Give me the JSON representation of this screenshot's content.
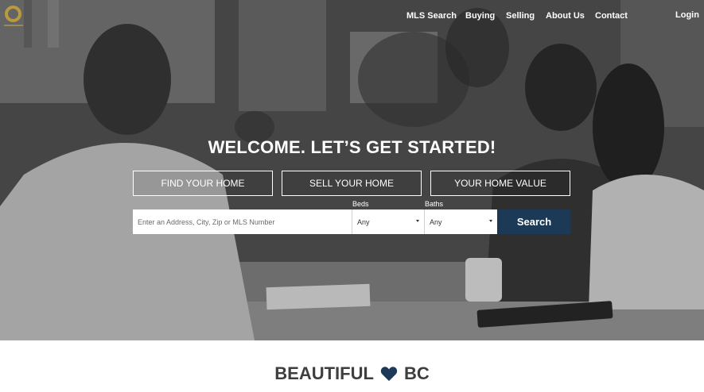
{
  "nav": {
    "items": [
      {
        "label": "MLS Search",
        "icon": ""
      },
      {
        "label": "Buying"
      },
      {
        "label": "Selling"
      },
      {
        "label": "About Us"
      },
      {
        "label": "Contact"
      }
    ],
    "login_label": "Login"
  },
  "logo": {
    "icon": "brand-ring-logo",
    "color": "#b89b3e"
  },
  "hero": {
    "headline": "WELCOME. LET’S GET STARTED!",
    "options": [
      "FIND YOUR HOME",
      "SELL YOUR HOME",
      "YOUR HOME VALUE"
    ]
  },
  "search": {
    "placeholder": "Enter an Address, City, Zip or MLS Number",
    "beds_label": "Beds",
    "beds_value": "Any",
    "baths_label": "Baths",
    "baths_value": "Any",
    "button_label": "Search",
    "button_color": "#1c3a56"
  },
  "section": {
    "title_left": "BEAUTIFUL",
    "title_right": "BC",
    "heart_icon": "heart-icon",
    "heart_color": "#1c3a56"
  }
}
